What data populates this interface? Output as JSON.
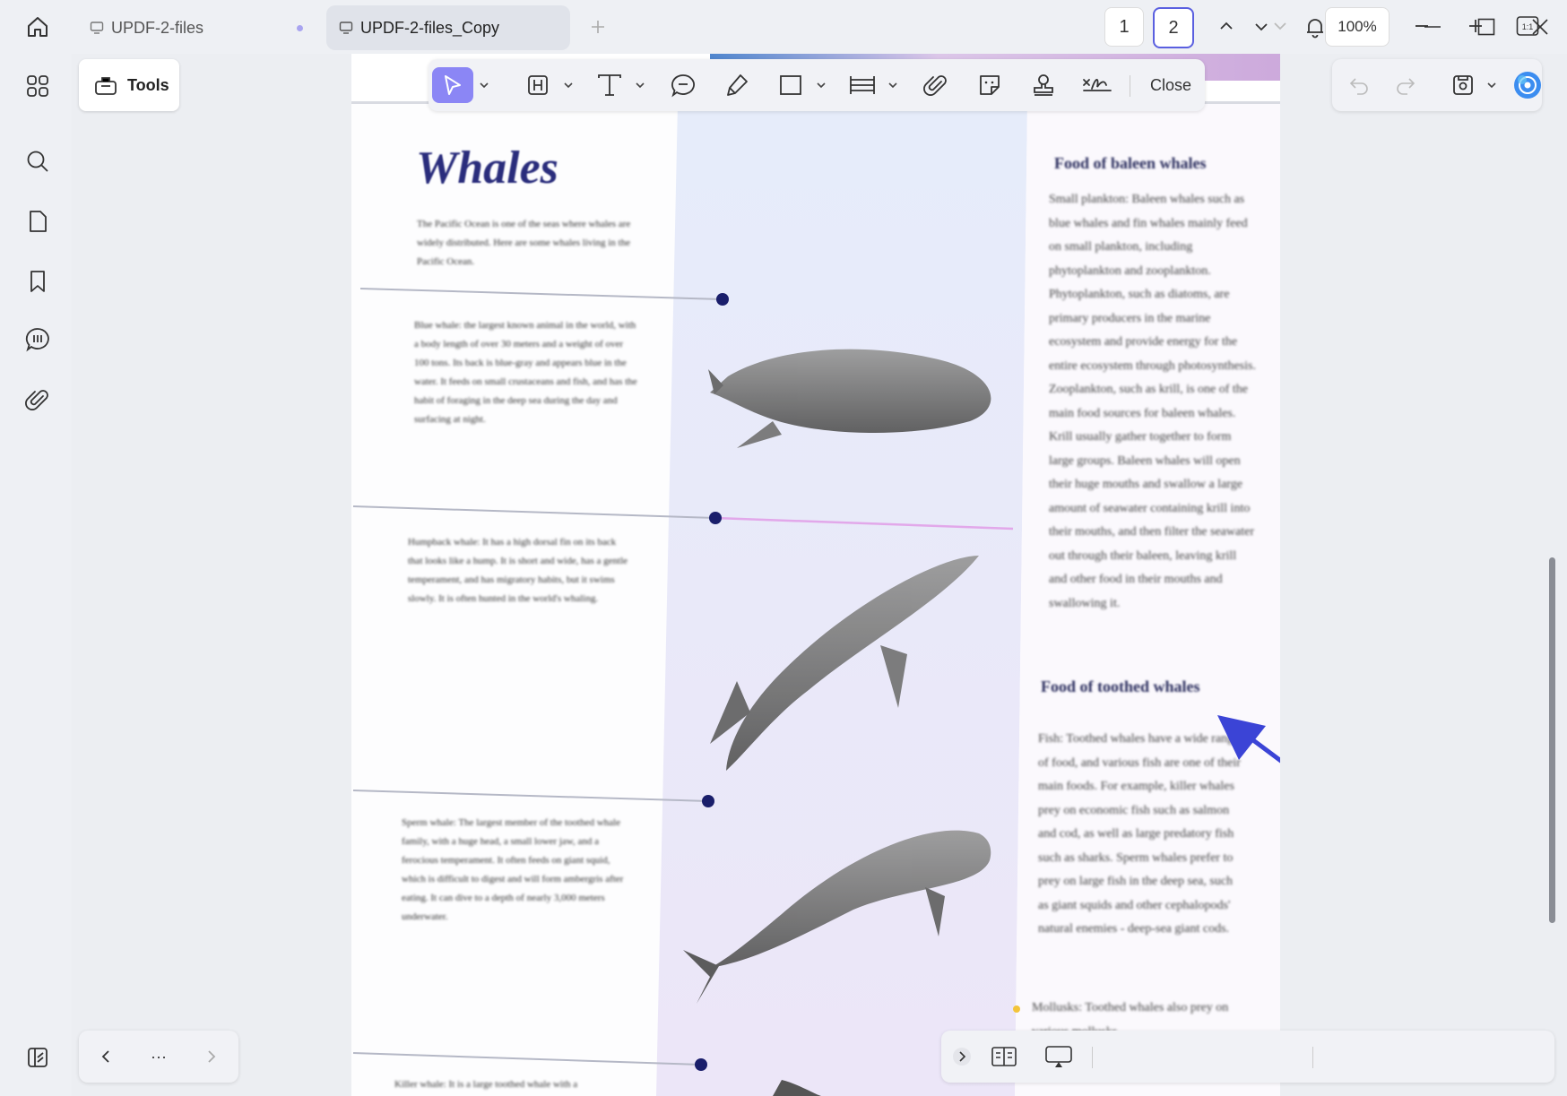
{
  "tabs": [
    {
      "label": "UPDF-2-files"
    },
    {
      "label": "UPDF-2-files_Copy"
    }
  ],
  "sidebar": {
    "tools_label": "Tools"
  },
  "toolbar": {
    "close_label": "Close"
  },
  "document": {
    "title": "Whales",
    "intro": "The Pacific Ocean is one of the seas where whales are widely distributed. Here are some whales living in the Pacific Ocean.",
    "blue": "Blue whale: the largest known animal in the world, with a body length of over 30 meters and a weight of over 100 tons. Its back is blue-gray and appears blue in the water. It feeds on small crustaceans and fish, and has the habit of foraging in the deep sea during the day and surfacing at night.",
    "humpback": "Humpback whale: It has a high dorsal fin on its back that looks like a hump. It is short and wide, has a gentle temperament, and has migratory habits, but it swims slowly. It is often hunted in the world's whaling.",
    "sperm": "Sperm whale: The largest member of the toothed whale family, with a huge head, a small lower jaw, and a ferocious temperament. It often feeds on giant squid, which is difficult to digest and will form ambergris after eating. It can dive to a depth of nearly 3,000 meters underwater.",
    "killer": "Killer whale: It is a large toothed whale with a",
    "baleen_heading": "Food of baleen whales",
    "baleen_text": "Small plankton: Baleen whales such as blue whales and fin whales mainly feed on small plankton, including phytoplankton and zooplankton. Phytoplankton, such as diatoms, are primary producers in the marine ecosystem and provide energy for the entire ecosystem through photosynthesis. Zooplankton, such as krill, is one of the main food sources for baleen whales. Krill usually gather together to form large groups. Baleen whales will open their huge mouths and swallow a large amount of seawater containing krill into their mouths, and then filter the seawater out through their baleen, leaving krill and other food in their mouths and swallowing it.",
    "toothed_heading": "Food of toothed whales",
    "toothed_text": "Fish: Toothed whales have a wide range of food, and various fish are one of their main foods. For example, killer whales prey on economic fish such as salmon and cod, as well as large predatory fish such as sharks. Sperm whales prefer to prey on large fish in the deep sea, such as giant squids and other cephalopods' natural enemies - deep-sea giant cods.",
    "mollusks": "Mollusks: Toothed whales also prey on various mollusks"
  },
  "pagination": {
    "page1": "1",
    "page2": "2",
    "zoom": "100%",
    "fit_label": "1:1"
  },
  "nav": {
    "more": "···"
  },
  "colors": {
    "accent": "#5a5fe0",
    "select": "#8b86f5",
    "arrow": "#3b44d6",
    "title": "#2a2d7c"
  },
  "icons": [
    "home-icon",
    "apps-icon",
    "search-icon",
    "pages-icon",
    "bookmark-icon",
    "comment-icon",
    "attachment-icon",
    "bell-icon",
    "user-icon",
    "minimize-icon",
    "maximize-icon",
    "close-icon",
    "chevron-down-icon",
    "plus-icon",
    "tools-icon",
    "pointer-icon",
    "highlight-icon",
    "text-icon",
    "note-icon",
    "pen-icon",
    "shape-icon",
    "measure-icon",
    "attach-icon",
    "sticker-icon",
    "stamp-icon",
    "signature-icon",
    "undo-icon",
    "redo-icon",
    "save-icon",
    "ai-icon",
    "sidebar-toggle-icon"
  ]
}
